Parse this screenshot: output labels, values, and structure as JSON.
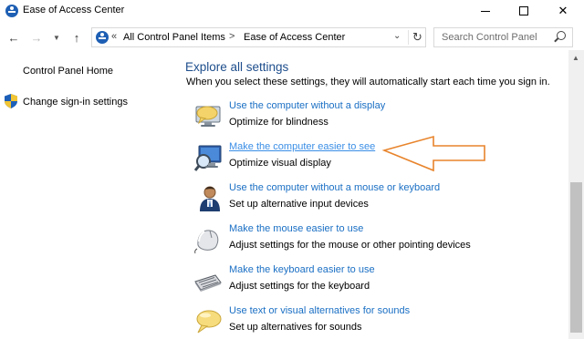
{
  "window": {
    "title": "Ease of Access Center",
    "icon": "ease-of-access-icon"
  },
  "nav": {
    "back_icon": "arrow-left-icon",
    "forward_icon": "arrow-right-icon",
    "recent_icon": "chevron-down-icon",
    "up_icon": "arrow-up-icon"
  },
  "address": {
    "chevron": "«",
    "crumbs": [
      "All Control Panel Items",
      "Ease of Access Center"
    ],
    "separator": ">",
    "refresh_icon": "refresh-icon"
  },
  "search": {
    "placeholder": "Search Control Panel",
    "icon": "search-icon"
  },
  "left_pane": {
    "home_link": "Control Panel Home",
    "signin_link": "Change sign-in settings",
    "signin_icon": "shield-icon"
  },
  "main": {
    "heading": "Explore all settings",
    "subheading": "When you select these settings, they will automatically start each time you sign in.",
    "items": [
      {
        "link": "Use the computer without a display",
        "desc": "Optimize for blindness",
        "icon": "speech-bubble-monitor-icon"
      },
      {
        "link": "Make the computer easier to see",
        "desc": "Optimize visual display",
        "icon": "magnifier-monitor-icon"
      },
      {
        "link": "Use the computer without a mouse or keyboard",
        "desc": "Set up alternative input devices",
        "icon": "person-icon"
      },
      {
        "link": "Make the mouse easier to use",
        "desc": "Adjust settings for the mouse or other pointing devices",
        "icon": "mouse-icon"
      },
      {
        "link": "Make the keyboard easier to use",
        "desc": "Adjust settings for the keyboard",
        "icon": "keyboard-icon"
      },
      {
        "link": "Use text or visual alternatives for sounds",
        "desc": "Set up alternatives for sounds",
        "icon": "speech-bubble-icon"
      }
    ]
  },
  "colors": {
    "link": "#1a6fc4",
    "heading": "#1e4e8c",
    "annotation_arrow": "#e8842c"
  }
}
